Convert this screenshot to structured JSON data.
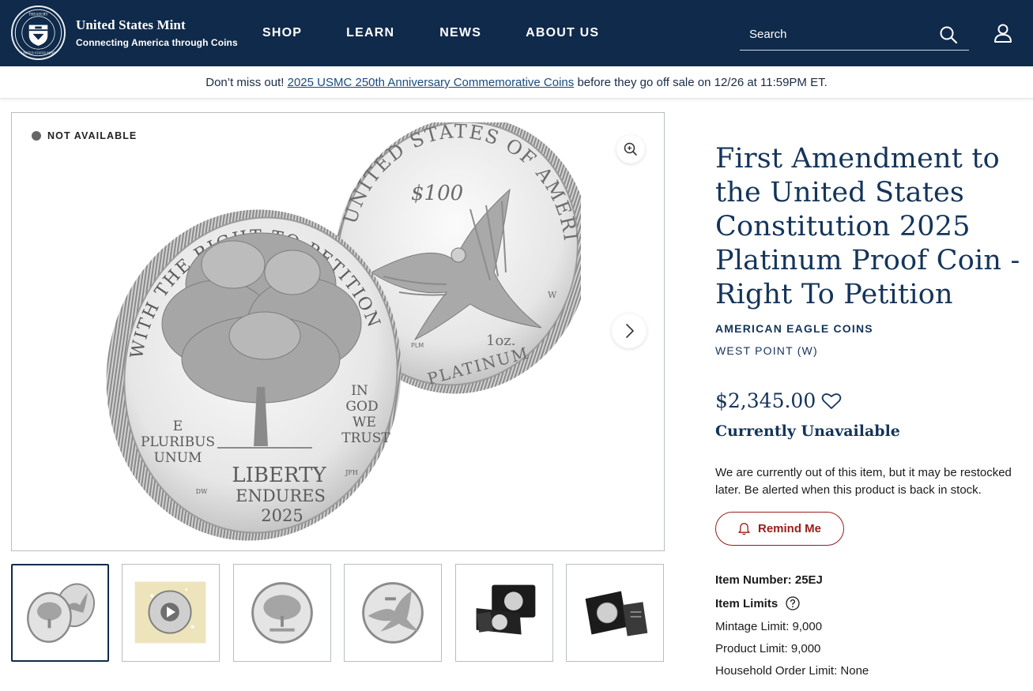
{
  "header": {
    "brand_name": "United States Mint",
    "brand_tagline": "Connecting America through Coins",
    "seal_text_top": "TREASURY",
    "seal_text_bottom": "UNITED STATES MINT",
    "nav": [
      "SHOP",
      "LEARN",
      "NEWS",
      "ABOUT US"
    ],
    "search_placeholder": "Search",
    "colors": {
      "header_bg": "#0f2a4a"
    }
  },
  "banner": {
    "prefix": "Don’t miss out!",
    "link_text": "2025 USMC 250th Anniversary Commemorative Coins",
    "suffix": "before they go off sale on 12/26 at 11:59PM ET."
  },
  "gallery": {
    "status": "NOT AVAILABLE",
    "coin_obverse": {
      "top_legend": "WITH THE RIGHT TO PETITION",
      "left_legend_1": "E",
      "left_legend_2": "PLURIBUS",
      "left_legend_3": "UNUM",
      "right_legend_1": "IN",
      "right_legend_2": "GOD",
      "right_legend_3": "WE",
      "right_legend_4": "TRUST",
      "bottom_1": "LIBERTY",
      "bottom_2": "ENDURES",
      "year": "2025",
      "initials_left": "DW",
      "initials_right": "JFH"
    },
    "coin_reverse": {
      "legend": "UNITED STATES OF AMERICA",
      "denomination": "$100",
      "weight": "1oz.",
      "metal": "PLATINUM",
      "mint_mark": "W",
      "initials": "PLM"
    },
    "thumbnail_count": 6,
    "active_thumbnail": 1
  },
  "product": {
    "title": "First Amendment to the United States Constitution 2025 Platinum Proof Coin - Right To Petition",
    "category": "AMERICAN EAGLE COINS",
    "mint": "WEST POINT (W)",
    "price": "$2,345.00",
    "availability": "Currently Unavailable",
    "stock_message": "We are currently out of this item, but it may be restocked later. Be alerted when this product is back in stock.",
    "remind_label": "Remind Me",
    "item_number": "Item Number: 25EJ",
    "item_limits_label": "Item Limits",
    "mintage_limit": "Mintage Limit: 9,000",
    "product_limit": "Product Limit: 9,000",
    "household_limit": "Household Order Limit: None",
    "colors": {
      "accent": "#14345a",
      "remind": "#9b1c1c"
    }
  }
}
